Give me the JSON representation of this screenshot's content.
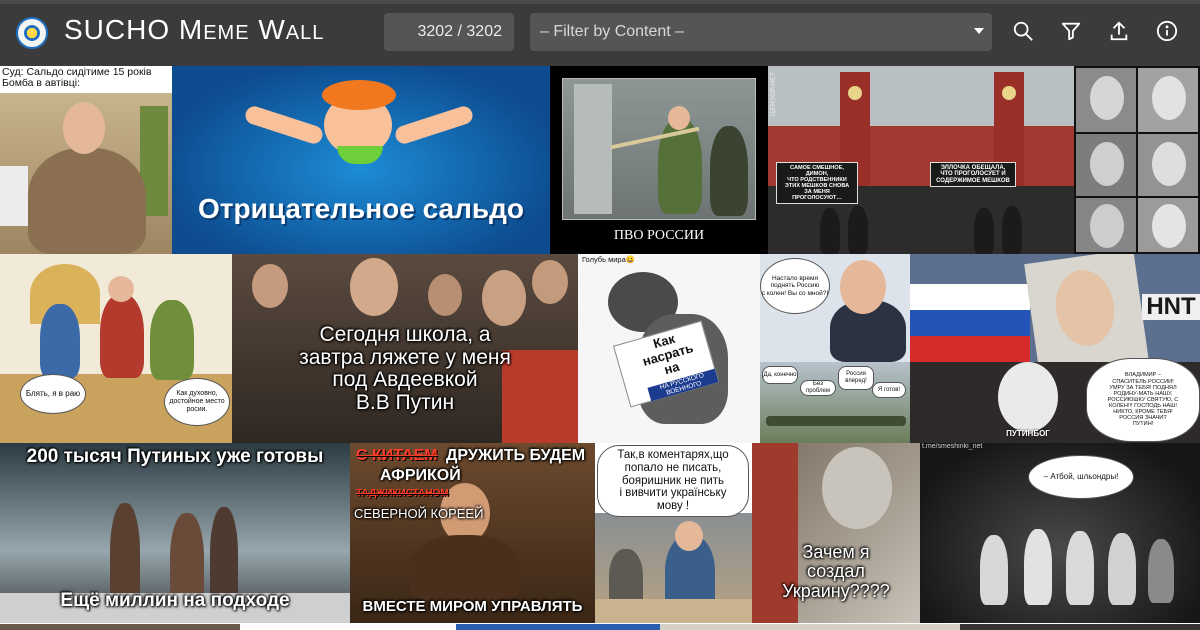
{
  "app": {
    "title": "SUCHO Meme Wall",
    "counter": "3202 / 3202",
    "filter": {
      "placeholder": "– Filter by Content –"
    }
  },
  "toolbar": {
    "search_icon": "search-icon",
    "filter_icon": "filter-icon",
    "upload_icon": "upload-icon",
    "info_icon": "info-icon"
  },
  "colors": {
    "header_bg": "#3b3b3b",
    "control_bg": "#555555",
    "text": "#ffffff"
  },
  "memes": [
    {
      "id": "m1",
      "caption": "Суд: Сальдо сидітиме 15 років\nБомба в автівці:"
    },
    {
      "id": "m2",
      "caption": "Отрицательное сальдо"
    },
    {
      "id": "m3",
      "caption": "ПВО РОССИИ"
    },
    {
      "id": "m4",
      "caption": "САМОЕ СМЕШНОЕ, ДИМОН,\nЧТО РОДСТВЕННИКИ\nЭТИХ МЕШКОВ СНОВА\nЗА МЕНЯ ПРОГОЛОСУЮТ…",
      "stamp": "ЦЕНЗОР.НЕТ"
    },
    {
      "id": "m5",
      "caption": "ЭЛЛОЧКА ОБЕЩАЛА,\nЧТО ПРОГОЛОСУЕТ И\nСОДЕРЖИМОЕ МЕШКОВ"
    },
    {
      "id": "m6",
      "caption": ""
    },
    {
      "id": "m7",
      "bubble_left": "Блять, я в раю",
      "bubble_right": "Как духовно,\nдостойное место\nросии."
    },
    {
      "id": "m8",
      "caption": "Сегодня школа, а\nзавтра ляжете у меня\nпод Авдеевкой\nВ.В Путин"
    },
    {
      "id": "m9",
      "title": "Голубь мира😀",
      "sign": "Как\nнасрать\nна",
      "sign_sub": "НА РУССКОГО\nВОЕННОГО"
    },
    {
      "id": "m10",
      "bubble_top": "Настало время\nподнять Россию\nс колен! Вы со мной?!",
      "bubble_a": "Да, конечно",
      "bubble_b": "Без проблем",
      "bubble_c": "Россия\nвперед!",
      "bubble_d": "Я готов!"
    },
    {
      "id": "m11",
      "caption": "ВЛАДИМИР –\nСПАСИТЕЛЬ РОССИИ!\nУМРУ ЗА ТЕБЯ! ПОДНЯЛ\nРОДИНУ-МАТЬ НАШУ,\nРОССИЮШКУ СВЯТУЮ, С\nКОЛЕН!!! ГОСПОДЬ НАШ!\nНИКТО, КРОМЕ ТЕБЯ!\nРОССИЯ ЗНАЧИТ\nПУТИН!",
      "badge": "ПУТИНБОГ",
      "flag_text": "HNT"
    },
    {
      "id": "m12",
      "top": "200 тысяч Путиных уже готовы",
      "bottom": "Ещё миллин на подходе"
    },
    {
      "id": "m13",
      "line1_strike": "С КИТАЕМ",
      "line1": "ДРУЖИТЬ БУДЕМ",
      "line2": "АФРИКОЙ",
      "line3": "ТАДЖИКИСТАНОМ",
      "line4": "СЕВЕРНОЙ КОРЕЕЙ",
      "bottom": "ВМЕСТЕ МИРОМ УПРАВЛЯТЬ"
    },
    {
      "id": "m14",
      "caption": "Так,в коментарях,що\nпопало не писать,\nбояришник не пить\nі вивчити українську\nмову !"
    },
    {
      "id": "m15",
      "caption": "Зачем я\nсоздал\nУкраину????"
    },
    {
      "id": "m16",
      "watermark": "t.me/smeshinki_net",
      "bubble": "– Атбой, шльондры!"
    }
  ]
}
